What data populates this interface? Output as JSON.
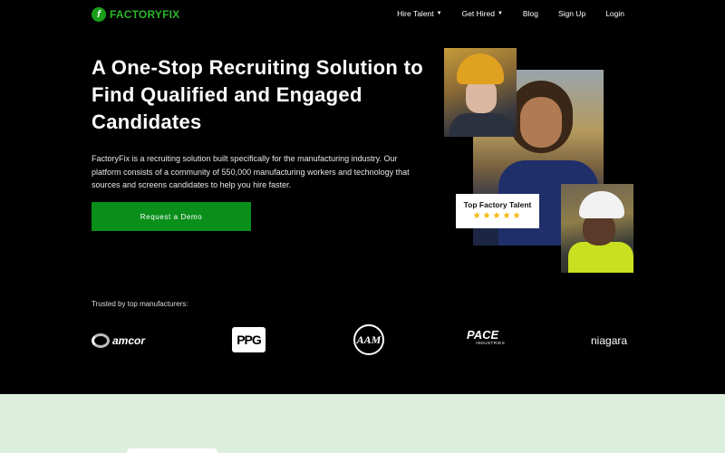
{
  "nav": {
    "logo_text": "FACTORYFIX",
    "logo_letter": "f",
    "links": [
      "Hire Talent",
      "Get Hired",
      "Blog",
      "Sign Up",
      "Login"
    ]
  },
  "hero": {
    "title": "A One-Stop Recruiting Solution to Find Qualified and Engaged Candidates",
    "description": "FactoryFix is a recruiting solution built specifically for the manufacturing industry. Our platform consists of a community of 550,000 manufacturing workers and technology that sources and screens candidates to help you hire faster.",
    "cta_label": "Request a Demo"
  },
  "badge": {
    "title": "Top Factory Talent",
    "stars": "★★★★★",
    "rating": 5
  },
  "trusted": {
    "label": "Trusted by top manufacturers:",
    "logos": {
      "amcor": "amcor",
      "ppg": "PPG",
      "aam": "AAM",
      "pace": "PACE",
      "pace_sub": "INDUSTRIES",
      "niagara": "niagara"
    }
  },
  "colors": {
    "accent": "#0a8f1a",
    "logo_green": "#2cb52c",
    "star": "#f5b400",
    "bottom_band": "#dcefdc"
  }
}
